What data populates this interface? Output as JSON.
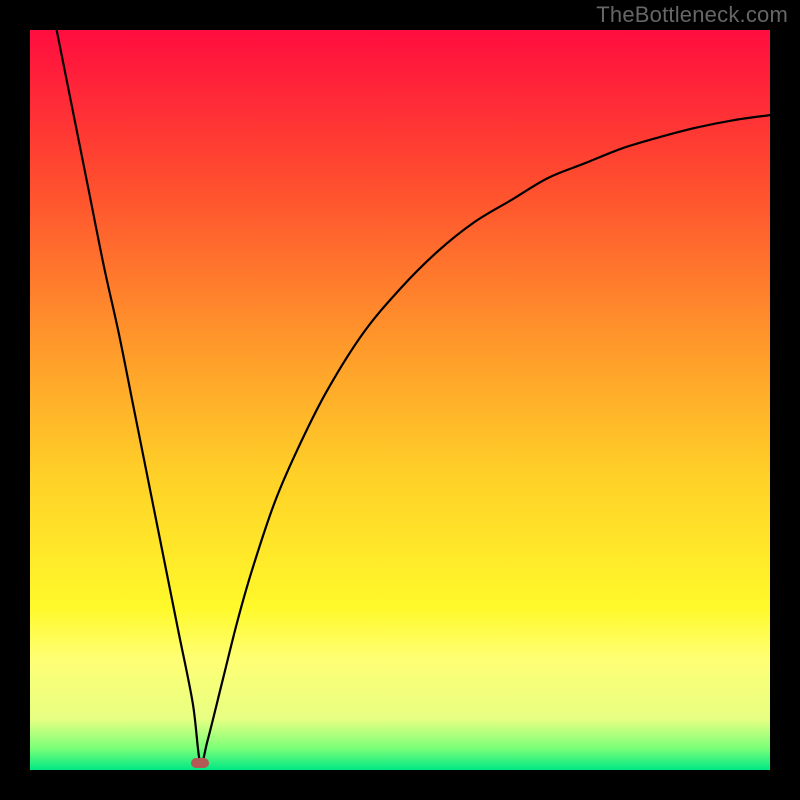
{
  "watermark": {
    "text": "TheBottleneck.com"
  },
  "chart_data": {
    "type": "line",
    "title": "",
    "xlabel": "",
    "ylabel": "",
    "xlim": [
      0,
      100
    ],
    "ylim": [
      0,
      100
    ],
    "grid": false,
    "legend": "none",
    "background_gradient": {
      "stops": [
        {
          "offset": 0.0,
          "color": "#ff0d3f"
        },
        {
          "offset": 0.2,
          "color": "#ff4b2f"
        },
        {
          "offset": 0.42,
          "color": "#ff972b"
        },
        {
          "offset": 0.6,
          "color": "#ffd028"
        },
        {
          "offset": 0.78,
          "color": "#fff92a"
        },
        {
          "offset": 0.85,
          "color": "#ffff74"
        },
        {
          "offset": 0.93,
          "color": "#e8ff82"
        },
        {
          "offset": 0.97,
          "color": "#7dff78"
        },
        {
          "offset": 1.0,
          "color": "#00e885"
        }
      ]
    },
    "curve": {
      "description": "Bottleneck curve: estimated bottleneck percentage from 0 (green, bottom) to 100 (red, top) along a normalized hardware axis 0..100. Minimum near x ≈ 23.",
      "series": [
        {
          "name": "bottleneck-curve",
          "x": [
            0,
            2,
            4,
            6,
            8,
            10,
            12,
            14,
            16,
            18,
            20,
            22,
            23,
            24,
            26,
            28,
            30,
            33,
            36,
            40,
            45,
            50,
            55,
            60,
            65,
            70,
            75,
            80,
            85,
            90,
            95,
            100
          ],
          "values": [
            118,
            108,
            98,
            88,
            78,
            68,
            59,
            49,
            39,
            29,
            19,
            9,
            1,
            4,
            12,
            20,
            27,
            36,
            43,
            51,
            59,
            65,
            70,
            74,
            77,
            80,
            82,
            84,
            85.5,
            86.8,
            87.8,
            88.5
          ]
        }
      ]
    },
    "marker": {
      "x": 23,
      "y": 1,
      "color": "#b35a56"
    }
  }
}
